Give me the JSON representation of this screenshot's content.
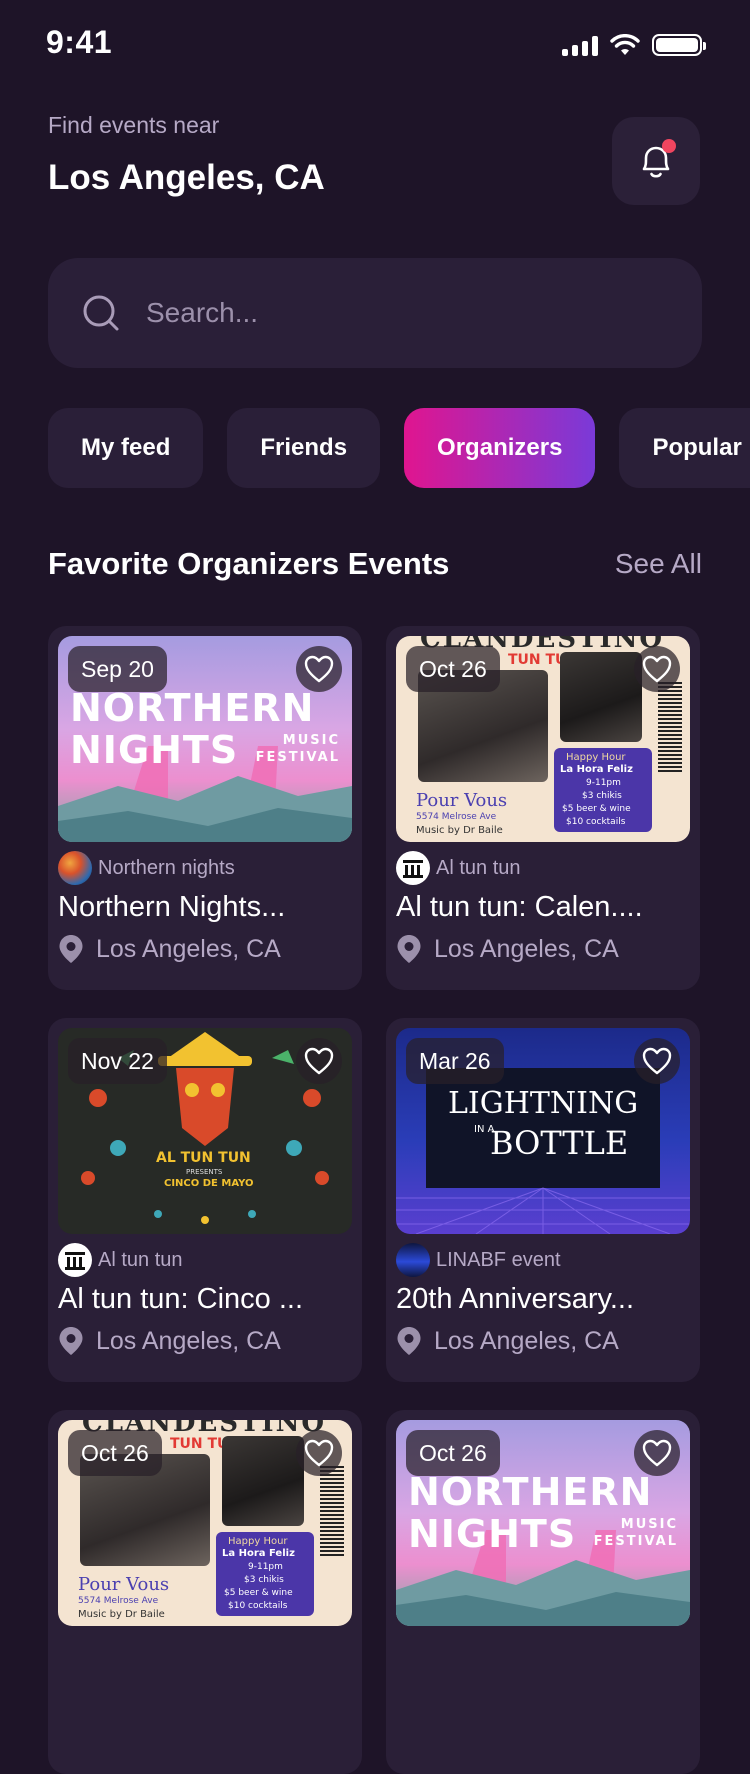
{
  "status_bar": {
    "time": "9:41"
  },
  "header": {
    "find_label": "Find events near",
    "location": "Los Angeles, CA"
  },
  "search": {
    "placeholder": "Search..."
  },
  "tabs": [
    {
      "label": "My feed",
      "active": false
    },
    {
      "label": "Friends",
      "active": false
    },
    {
      "label": "Organizers",
      "active": true
    },
    {
      "label": "Popular",
      "active": false
    }
  ],
  "section": {
    "title": "Favorite Organizers Events",
    "see_all": "See All"
  },
  "cards": [
    {
      "date": "Sep 20",
      "organizer": "Northern nights",
      "title": "Northern Nights...",
      "location": "Los Angeles, CA",
      "poster": {
        "line1": "NORTHERN",
        "line2": "NIGHTS",
        "line3": "MUSIC FESTIVAL"
      }
    },
    {
      "date": "Oct 26",
      "organizer": "Al tun tun",
      "title": "Al tun tun: Calen....",
      "location": "Los Angeles, CA",
      "poster": {
        "line1": "CLANDESTINO",
        "line2": "TUN TUN",
        "line3": "Pour Vous",
        "line4": "5574 Melrose Ave",
        "line5": "Music by Dr Baile",
        "line6": "Happy Hour",
        "line7": "La Hora Feliz",
        "line8": "9-11pm",
        "line9": "$3 chikis",
        "line10": "$5 beer & wine",
        "line11": "$10 cocktails"
      }
    },
    {
      "date": "Nov 22",
      "organizer": "Al tun tun",
      "title": "Al tun tun: Cinco ...",
      "location": "Los Angeles, CA",
      "poster": {
        "line1": "AL TUN TUN",
        "line2": "PRESENTS",
        "line3": "CINCO DE MAYO"
      }
    },
    {
      "date": "Mar 26",
      "organizer": "LINABF event",
      "title": "20th Anniversary...",
      "location": "Los Angeles, CA",
      "poster": {
        "line1": "LIGHTNING",
        "line2": "IN A",
        "line3": "BOTTLE"
      }
    },
    {
      "date": "Oct 26",
      "poster": {
        "line1": "CLANDESTINO",
        "line2": "TUN TUN",
        "line3": "Pour Vous",
        "line4": "5574 Melrose Ave",
        "line5": "Music by Dr Baile",
        "line6": "Happy Hour",
        "line7": "La Hora Feliz",
        "line8": "9-11pm",
        "line9": "$3 chikis",
        "line10": "$5 beer & wine",
        "line11": "$10 cocktails"
      }
    },
    {
      "date": "Oct 26",
      "poster": {
        "line1": "NORTHERN",
        "line2": "NIGHTS",
        "line3": "MUSIC FESTIVAL"
      }
    }
  ],
  "colors": {
    "background": "#1e1428",
    "surface": "#2a1f38",
    "accent_start": "#e0158f",
    "accent_end": "#7a3ad8",
    "notification_dot": "#f0455f",
    "muted_text": "#b6a9c6"
  },
  "icons": [
    "bell-icon",
    "search-icon",
    "heart-icon",
    "location-pin-icon",
    "wifi-icon",
    "signal-icon",
    "battery-icon"
  ]
}
